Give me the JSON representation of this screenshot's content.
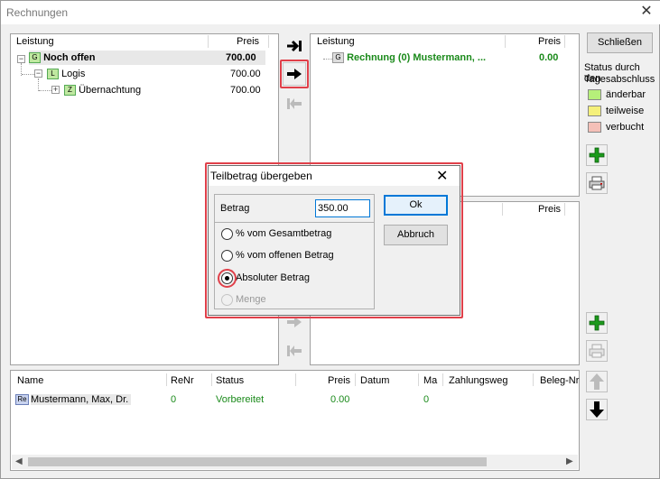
{
  "window": {
    "title": "Rechnungen"
  },
  "left_tree": {
    "col_leistung": "Leistung",
    "col_preis": "Preis",
    "rows": [
      {
        "badge": "G",
        "label": "Noch offen",
        "price": "700.00"
      },
      {
        "badge": "L",
        "label": "Logis",
        "price": "700.00"
      },
      {
        "badge": "Z",
        "label": "Übernachtung",
        "price": "700.00"
      }
    ]
  },
  "right_top": {
    "col_leistung": "Leistung",
    "col_preis": "Preis",
    "row": {
      "badge": "G",
      "label": "Rechnung (0) Mustermann, ...",
      "price": "0.00"
    }
  },
  "right_bottom": {
    "col_preis": "Preis"
  },
  "side": {
    "close_button": "Schließen",
    "status_heading_1": "Status durch den",
    "status_heading_2": "Tagesabschluss",
    "legend": [
      {
        "label": "änderbar",
        "color": "#b6f07a"
      },
      {
        "label": "teilweise",
        "color": "#f5f07a"
      },
      {
        "label": "verbucht",
        "color": "#f5c0b8"
      }
    ]
  },
  "dialog": {
    "title": "Teilbetrag übergeben",
    "betrag_label": "Betrag",
    "betrag_value": "350.00",
    "ok": "Ok",
    "cancel": "Abbruch",
    "options": [
      {
        "label": "% vom Gesamtbetrag",
        "selected": false,
        "enabled": true
      },
      {
        "label": "% vom offenen Betrag",
        "selected": false,
        "enabled": true
      },
      {
        "label": "Absoluter Betrag",
        "selected": true,
        "enabled": true
      },
      {
        "label": "Menge",
        "selected": false,
        "enabled": false
      }
    ]
  },
  "bottom_table": {
    "headers": [
      "Name",
      "ReNr",
      "Status",
      "Preis",
      "Datum",
      "Ma",
      "Zahlungsweg",
      "Beleg-Nr"
    ],
    "rows": [
      {
        "badge": "Re",
        "name": "Mustermann, Max, Dr.",
        "renr": "0",
        "status": "Vorbereitet",
        "preis": "0.00",
        "datum": "",
        "ma": "0",
        "zahlungsweg": "",
        "beleg": ""
      }
    ]
  },
  "colors": {
    "green_text": "#1a8a1a",
    "highlight": "#e0404a"
  }
}
